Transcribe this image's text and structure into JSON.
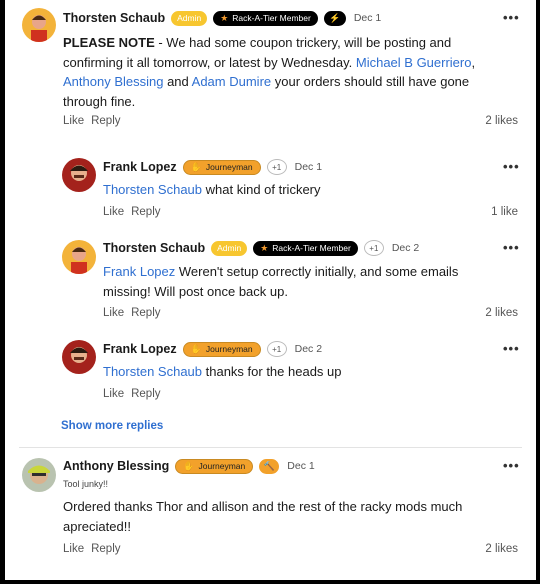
{
  "comments": [
    {
      "author": "Thorsten Schaub",
      "badges": {
        "admin": "Admin",
        "rack": "Rack-A-Tier Member",
        "bolt_icon": "lightning-bolt-icon"
      },
      "date": "Dec 1",
      "text_parts": [
        "PLEASE NOTE",
        " - We had some coupon trickery, will be posting and confirming it all tomorrow, or latest by Wednesday. ",
        "Michael B Guerriero",
        ", ",
        "Anthony Blessing",
        " and ",
        "Adam Dumire",
        " your orders should still have gone through fine."
      ],
      "like": "Like",
      "reply": "Reply",
      "likes": "2 likes"
    },
    {
      "author": "Frank Lopez",
      "badges": {
        "journeyman": "Journeyman",
        "plus": "+1"
      },
      "date": "Dec 1",
      "mention": "Thorsten Schaub",
      "text": " what kind of trickery",
      "like": "Like",
      "reply": "Reply",
      "likes": "1 like"
    },
    {
      "author": "Thorsten Schaub",
      "badges": {
        "admin": "Admin",
        "rack": "Rack-A-Tier Member",
        "plus": "+1"
      },
      "date": "Dec 2",
      "mention": "Frank Lopez",
      "text": " Weren't setup correctly initially, and some emails missing! Will post once back up.",
      "like": "Like",
      "reply": "Reply",
      "likes": "2 likes"
    },
    {
      "author": "Frank Lopez",
      "badges": {
        "journeyman": "Journeyman",
        "plus": "+1"
      },
      "date": "Dec 2",
      "mention": "Thorsten Schaub",
      "text": " thanks for the heads up",
      "like": "Like",
      "reply": "Reply"
    },
    {
      "author": "Anthony Blessing",
      "badges": {
        "journeyman": "Journeyman",
        "hammer_icon": "hammer-icon"
      },
      "date": "Dec 1",
      "subtitle": "Tool junky!!",
      "text": "Ordered thanks Thor and allison and the rest of the racky mods much apreciated!!",
      "like": "Like",
      "reply": "Reply",
      "likes": "2 likes"
    }
  ],
  "show_more_replies": "Show more replies",
  "more_menu": "•••",
  "colors": {
    "mention": "#2f6fd0",
    "admin_badge": "#f7c62f",
    "journeyman_badge": "#f2a12b",
    "rack_badge": "#000000"
  }
}
